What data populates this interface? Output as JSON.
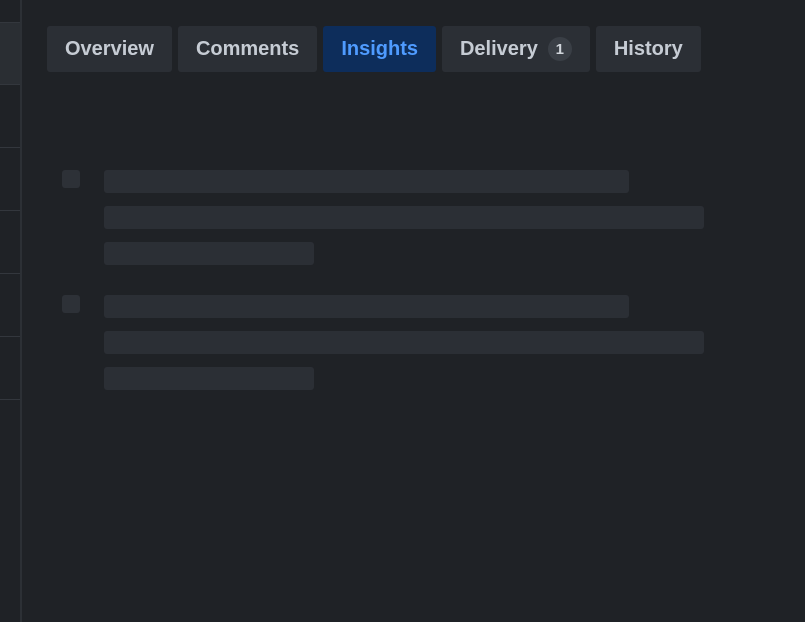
{
  "tabs": [
    {
      "label": "Overview",
      "active": false,
      "badge": null
    },
    {
      "label": "Comments",
      "active": false,
      "badge": null
    },
    {
      "label": "Insights",
      "active": true,
      "badge": null
    },
    {
      "label": "Delivery",
      "active": false,
      "badge": "1"
    },
    {
      "label": "History",
      "active": false,
      "badge": null
    }
  ],
  "content": {
    "state": "loading",
    "skeleton_items": 2,
    "lines_per_item": 3
  },
  "colors": {
    "background": "#1f2226",
    "tab_bg": "#2b2f35",
    "tab_text": "#c6ccd4",
    "tab_active_bg": "#0d2d5b",
    "tab_active_text": "#4f9bff",
    "skeleton": "#2b2f35"
  }
}
